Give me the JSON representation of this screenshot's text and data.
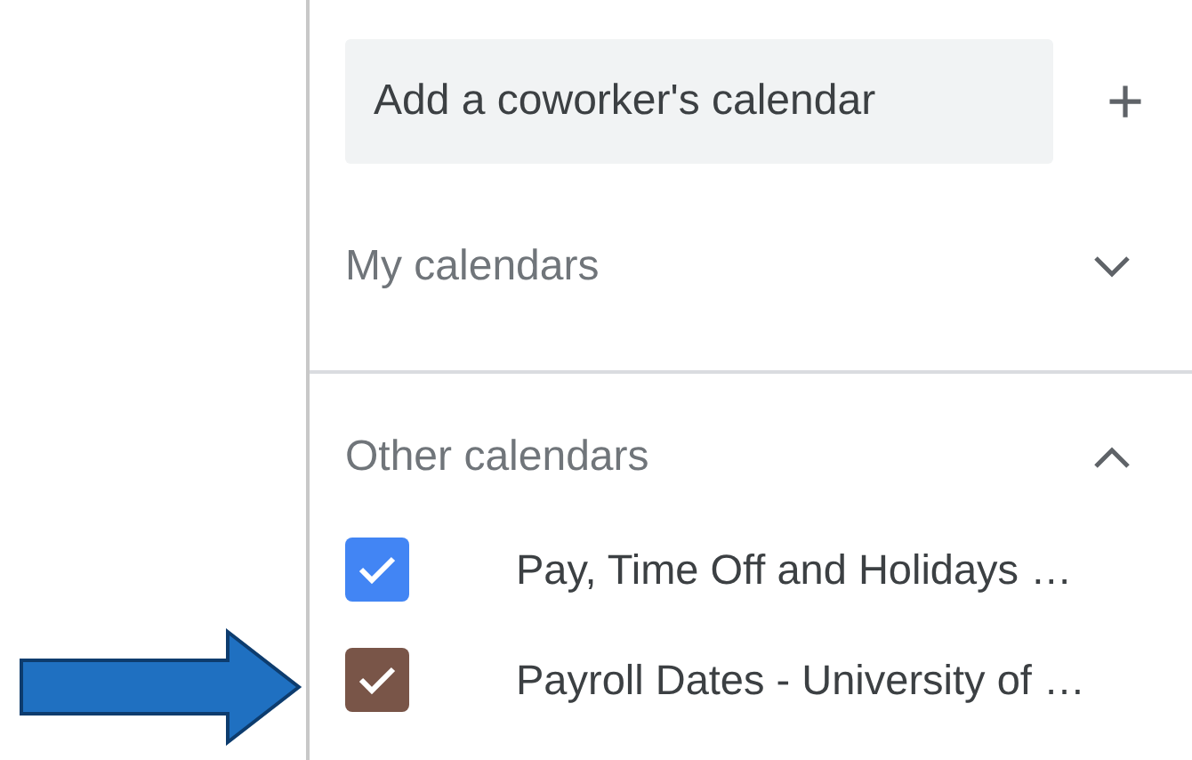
{
  "search": {
    "placeholder": "Add a coworker's calendar",
    "add_button": "+"
  },
  "sections": [
    {
      "title": "My calendars",
      "expanded": false
    },
    {
      "title": "Other calendars",
      "expanded": true,
      "items": [
        {
          "label": "Pay, Time Off and Holidays …",
          "checked": true,
          "color": "#4285f4"
        },
        {
          "label": "Payroll Dates - University of …",
          "checked": true,
          "color": "#795548"
        }
      ]
    }
  ],
  "annotation": {
    "kind": "arrow",
    "color": "#1f70c1"
  }
}
